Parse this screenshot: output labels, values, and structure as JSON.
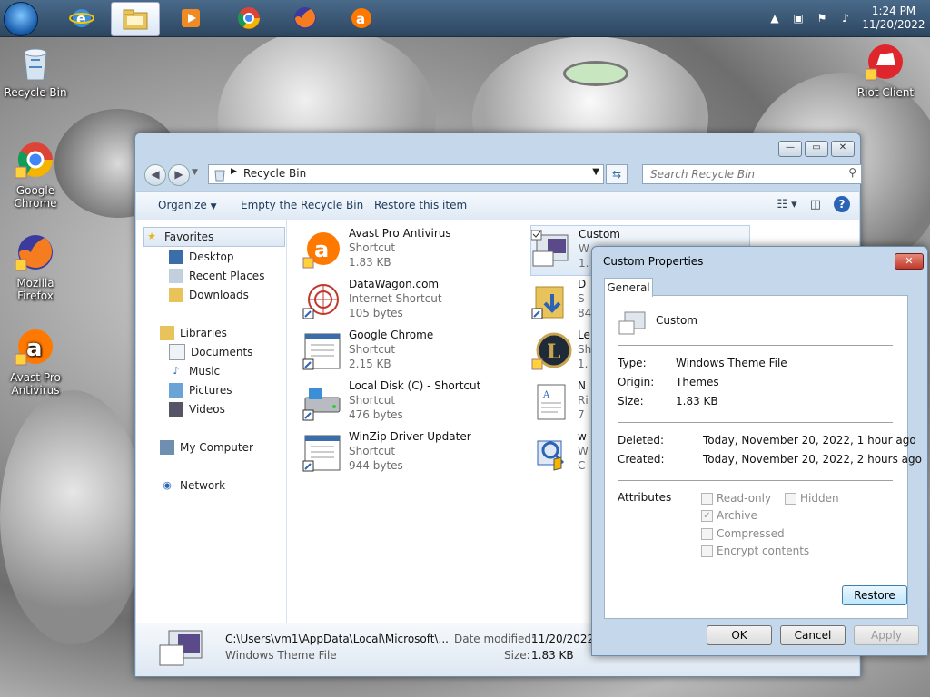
{
  "taskbar": {
    "clock_time": "1:24 PM",
    "clock_date": "11/20/2022"
  },
  "desktop": {
    "icons": [
      {
        "label": "Recycle Bin"
      },
      {
        "label": "Google Chrome"
      },
      {
        "label": "Mozilla Firefox"
      },
      {
        "label": "Avast Pro Antivirus"
      },
      {
        "label": "Riot Client"
      }
    ]
  },
  "explorer": {
    "address": "Recycle Bin",
    "search_placeholder": "Search Recycle Bin",
    "toolbar": {
      "organize": "Organize",
      "empty": "Empty the Recycle Bin",
      "restore": "Restore this item"
    },
    "nav": {
      "favorites": "Favorites",
      "desktop": "Desktop",
      "recent": "Recent Places",
      "downloads": "Downloads",
      "libraries": "Libraries",
      "documents": "Documents",
      "music": "Music",
      "pictures": "Pictures",
      "videos": "Videos",
      "computer": "My Computer",
      "network": "Network"
    },
    "files": [
      {
        "name": "Avast Pro Antivirus",
        "type": "Shortcut",
        "size": "1.83 KB"
      },
      {
        "name": "DataWagon.com",
        "type": "Internet Shortcut",
        "size": "105 bytes"
      },
      {
        "name": "Google Chrome",
        "type": "Shortcut",
        "size": "2.15 KB"
      },
      {
        "name": "Local Disk (C) - Shortcut",
        "type": "Shortcut",
        "size": "476 bytes"
      },
      {
        "name": "WinZip Driver Updater",
        "type": "Shortcut",
        "size": "944 bytes"
      },
      {
        "name": "Custom",
        "type": "W",
        "size": "1."
      },
      {
        "name": "D",
        "type": "S",
        "size": "84"
      },
      {
        "name": "Le",
        "type": "Sh",
        "size": "1."
      },
      {
        "name": "N",
        "type": "Ri",
        "size": "7"
      },
      {
        "name": "w",
        "type": "W",
        "size": "C"
      }
    ],
    "details": {
      "path": "C:\\Users\\vm1\\AppData\\Local\\Microsoft\\...",
      "type": "Windows Theme File",
      "date_label": "Date modified:",
      "date_value": "11/20/2022 1",
      "size_label": "Size:",
      "size_value": "1.83 KB"
    }
  },
  "props": {
    "title": "Custom Properties",
    "tab": "General",
    "filename": "Custom",
    "type_label": "Type:",
    "type_value": "Windows Theme File",
    "origin_label": "Origin:",
    "origin_value": "Themes",
    "size_label": "Size:",
    "size_value": "1.83 KB",
    "deleted_label": "Deleted:",
    "deleted_value": "Today, November 20, 2022, 1 hour ago",
    "created_label": "Created:",
    "created_value": "Today, November 20, 2022, 2 hours ago",
    "attributes_label": "Attributes",
    "readonly": "Read-only",
    "hidden": "Hidden",
    "archive": "Archive",
    "compressed": "Compressed",
    "encrypt": "Encrypt contents",
    "restore_btn": "Restore",
    "ok_btn": "OK",
    "cancel_btn": "Cancel",
    "apply_btn": "Apply"
  },
  "colors": {
    "avast": "#ff7800",
    "chrome_red": "#db4437",
    "help_blue": "#2b64b4"
  }
}
